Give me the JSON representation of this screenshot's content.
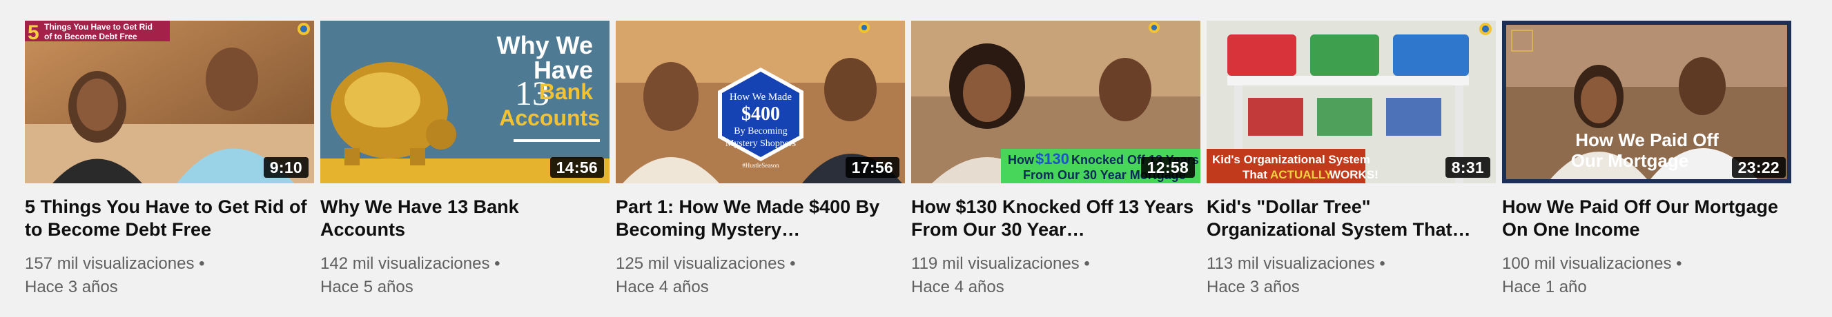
{
  "videos": [
    {
      "title": "5 Things You Have to Get Rid of to Become Debt Free",
      "views": "157 mil visualizaciones",
      "age": "Hace 3 años",
      "duration": "9:10",
      "thumb_text": [
        "5",
        "Things You Have to Get Rid",
        "of to Become Debt Free"
      ]
    },
    {
      "title": "Why We Have 13 Bank Accounts",
      "views": "142 mil visualizaciones",
      "age": "Hace 5 años",
      "duration": "14:56",
      "thumb_text": [
        "Why We",
        "Have",
        "13",
        "Bank",
        "Accounts"
      ]
    },
    {
      "title": "Part 1: How We Made $400 By Becoming Mystery…",
      "views": "125 mil visualizaciones",
      "age": "Hace 4 años",
      "duration": "17:56",
      "thumb_text": [
        "How We Made",
        "$400",
        "By Becoming",
        "Mystery Shoppers",
        "#HustleSeason"
      ]
    },
    {
      "title": "How $130 Knocked Off 13 Years From Our 30 Year…",
      "views": "119 mil visualizaciones",
      "age": "Hace 4 años",
      "duration": "12:58",
      "thumb_text": [
        "How",
        "$130",
        "Knocked Off 13 Years",
        "From Our 30 Year Mortgage"
      ]
    },
    {
      "title": "Kid's \"Dollar Tree\" Organizational System That…",
      "views": "113 mil visualizaciones",
      "age": "Hace 3 años",
      "duration": "8:31",
      "thumb_text": [
        "Kid's Organizational System",
        "That",
        "ACTUALLY",
        "WORKS!"
      ]
    },
    {
      "title": "How We Paid Off Our Mortgage On One Income",
      "views": "100 mil visualizaciones",
      "age": "Hace 1 año",
      "duration": "23:22",
      "thumb_text": [
        "How We Paid Off",
        "Our Mortgage"
      ]
    }
  ],
  "colors": {
    "title": "#0f0f0f",
    "meta": "#606060",
    "background": "#f1f1f1",
    "duration_bg": "#000000"
  }
}
